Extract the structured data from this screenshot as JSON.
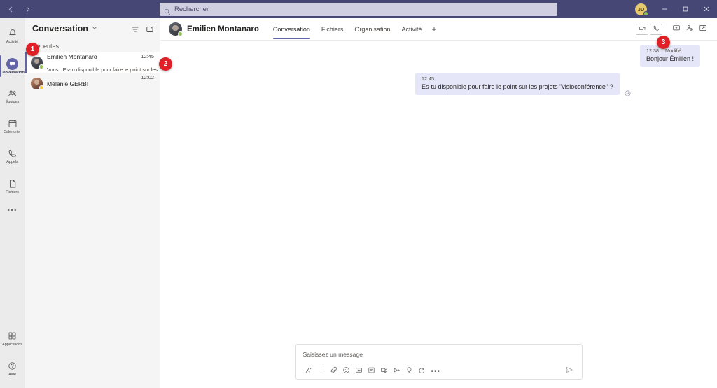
{
  "window": {
    "back_icon": "chevron-left-icon",
    "forward_icon": "chevron-right-icon",
    "minimize_label": "–",
    "maximize_label": "☐",
    "close_label": "✕",
    "avatar_initials": "JD",
    "presence": "online"
  },
  "search": {
    "placeholder": "Rechercher",
    "icon": "search-icon"
  },
  "rail": {
    "items": [
      {
        "label": "Activité",
        "icon": "bell-icon",
        "active": false
      },
      {
        "label": "Conversation",
        "icon": "chat-icon",
        "active": true
      },
      {
        "label": "Équipes",
        "icon": "teams-icon",
        "active": false
      },
      {
        "label": "Calendrier",
        "icon": "calendar-icon",
        "active": false
      },
      {
        "label": "Appels",
        "icon": "phone-icon",
        "active": false
      },
      {
        "label": "Fichiers",
        "icon": "file-icon",
        "active": false
      }
    ],
    "more_label": "•••",
    "bottom_items": [
      {
        "label": "Applications",
        "icon": "apps-icon"
      },
      {
        "label": "Aide",
        "icon": "help-icon"
      }
    ]
  },
  "chat_list": {
    "title": "Conversation",
    "caret_icon": "chevron-down-icon",
    "filter_icon": "filter-icon",
    "compose_icon": "new-chat-icon",
    "section_label": "Récentes",
    "items": [
      {
        "name": "Emilien Montanaro",
        "preview": "Vous : Es-tu disponible pour faire le point sur les...",
        "time": "12:45",
        "presence": "online",
        "selected": true
      },
      {
        "name": "Mélanie GERBI",
        "preview": "",
        "time": "12:02",
        "presence": "away",
        "selected": false
      }
    ]
  },
  "conversation": {
    "contact_name": "Emilien Montanaro",
    "contact_presence": "online",
    "tabs": [
      {
        "label": "Conversation",
        "active": true
      },
      {
        "label": "Fichiers",
        "active": false
      },
      {
        "label": "Organisation",
        "active": false
      },
      {
        "label": "Activité",
        "active": false
      }
    ],
    "add_tab_label": "+",
    "actions": [
      {
        "name": "video-call-button",
        "icon": "video-camera-icon"
      },
      {
        "name": "audio-call-button",
        "icon": "phone-icon"
      },
      {
        "name": "share-screen-button",
        "icon": "screen-share-icon"
      },
      {
        "name": "add-people-button",
        "icon": "add-person-icon"
      },
      {
        "name": "popout-button",
        "icon": "popout-icon"
      }
    ],
    "messages": [
      {
        "direction": "out",
        "time": "12:38",
        "edited_label": "Modifié",
        "text": "Bonjour Émilien !",
        "seen": false
      },
      {
        "direction": "in",
        "time": "12:45",
        "edited_label": "",
        "text": "Es-tu disponible pour faire le point sur les projets \"visioconférence\" ?",
        "seen": true,
        "seen_icon": "seen-check-icon"
      }
    ]
  },
  "compose": {
    "placeholder": "Saisissez un message",
    "tools": [
      {
        "name": "format-button",
        "icon": "format-text-icon"
      },
      {
        "name": "priority-button",
        "icon": "exclamation-icon"
      },
      {
        "name": "attach-button",
        "icon": "paperclip-icon"
      },
      {
        "name": "emoji-button",
        "icon": "emoji-icon"
      },
      {
        "name": "giphy-button",
        "icon": "giphy-icon"
      },
      {
        "name": "sticker-button",
        "icon": "sticker-icon"
      },
      {
        "name": "meet-now-button",
        "icon": "meeting-camera-icon"
      },
      {
        "name": "stream-button",
        "icon": "stream-icon"
      },
      {
        "name": "praise-button",
        "icon": "lightbulb-icon"
      },
      {
        "name": "loop-button",
        "icon": "loop-icon"
      }
    ],
    "more_label": "•••",
    "send_icon": "send-icon"
  },
  "annotations": [
    {
      "label": "1"
    },
    {
      "label": "2"
    },
    {
      "label": "3"
    }
  ]
}
